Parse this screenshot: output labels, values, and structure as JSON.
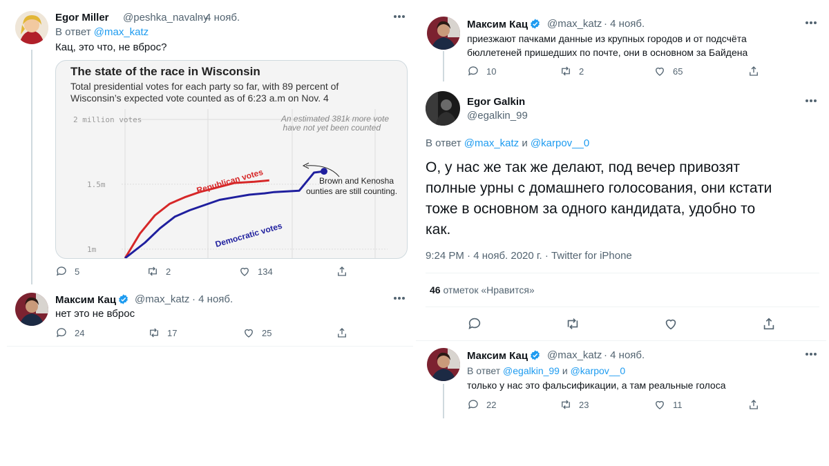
{
  "left": {
    "tweet1": {
      "name": "Egor Miller",
      "handle": "@peshka_navalny",
      "date": "· 4 нояб.",
      "reply_prefix": "В ответ",
      "reply_to": "@max_katz",
      "text": "Кац, это что, не вброс?",
      "chart_card": {
        "title": "The state of the race in Wisconsin",
        "subtitle_line1": "Total presidential votes for each party so far, with 89 percent of",
        "subtitle_line2": "Wisconsin’s expected vote counted as of 6:23 a.m on Nov. 4"
      },
      "stats": {
        "replies": "5",
        "retweets": "2",
        "likes": "134"
      }
    },
    "tweet2": {
      "name": "Максим Кац",
      "handle": "@max_katz",
      "date": "· 4 нояб.",
      "text": "нет это не вброс",
      "stats": {
        "replies": "24",
        "retweets": "17",
        "likes": "25"
      }
    }
  },
  "right": {
    "tweet1": {
      "name": "Максим Кац",
      "handle": "@max_katz",
      "date": "· 4 нояб.",
      "text_line1": "приезжают пачками данные из крупных городов и от подсчёта",
      "text_line2": "бюллетеней пришедших по почте, они в основном за Байдена",
      "stats": {
        "replies": "10",
        "retweets": "2",
        "likes": "65"
      }
    },
    "main": {
      "name": "Egor Galkin",
      "handle": "@egalkin_99",
      "reply_prefix": "В ответ",
      "reply_to_1": "@max_katz",
      "reply_and": "и",
      "reply_to_2": "@karpov__0",
      "text_line1": "О, у нас же так же делают, под вечер привозят",
      "text_line2": "полные урны с домашнего голосования, они кстати",
      "text_line3": "тоже в основном за одного кандидата, удобно то",
      "text_line4": "как.",
      "time": "9:24 PM · 4 нояб. 2020 г. · Twitter for iPhone",
      "likes_count": "46",
      "likes_label": "отметок «Нравится»"
    },
    "tweet3": {
      "name": "Максим Кац",
      "handle": "@max_katz",
      "date": "· 4 нояб.",
      "reply_prefix": "В ответ",
      "reply_to_1": "@egalkin_99",
      "reply_and": "и",
      "reply_to_2": "@karpov__0",
      "text": "только у нас это фальсификации, а там реальные голоса",
      "stats": {
        "replies": "22",
        "retweets": "23",
        "likes": "11"
      }
    }
  },
  "chart_data": {
    "type": "line",
    "title": "The state of the race in Wisconsin",
    "subtitle": "Total presidential votes for each party so far, with 89 percent of Wisconsin’s expected vote counted as of 6:23 a.m on Nov. 4",
    "ytick_labels": [
      "2 million votes",
      "1.5m",
      "1m"
    ],
    "ylim": [
      0.93,
      2.0
    ],
    "xlim": [
      0,
      100
    ],
    "series": [
      {
        "name": "Republican votes",
        "color": "#d62728",
        "x": [
          0,
          6,
          12,
          18,
          24,
          30,
          36,
          40,
          44,
          52,
          58
        ],
        "y": [
          0.93,
          1.12,
          1.26,
          1.35,
          1.4,
          1.44,
          1.47,
          1.49,
          1.51,
          1.52,
          1.53
        ]
      },
      {
        "name": "Democratic votes",
        "color": "#1f1f9e",
        "x": [
          0,
          8,
          14,
          20,
          26,
          32,
          38,
          44,
          50,
          56,
          60,
          70,
          76,
          80
        ],
        "y": [
          0.93,
          1.05,
          1.16,
          1.25,
          1.3,
          1.34,
          1.38,
          1.4,
          1.42,
          1.43,
          1.44,
          1.45,
          1.59,
          1.6
        ]
      }
    ],
    "annotations": [
      "An estimated 381k more votes have not yet been counted",
      "Brown and Kenosha counties are still counting."
    ],
    "colors": {
      "link": "#1d9bf0",
      "thread_line": "#cfd9de"
    }
  }
}
